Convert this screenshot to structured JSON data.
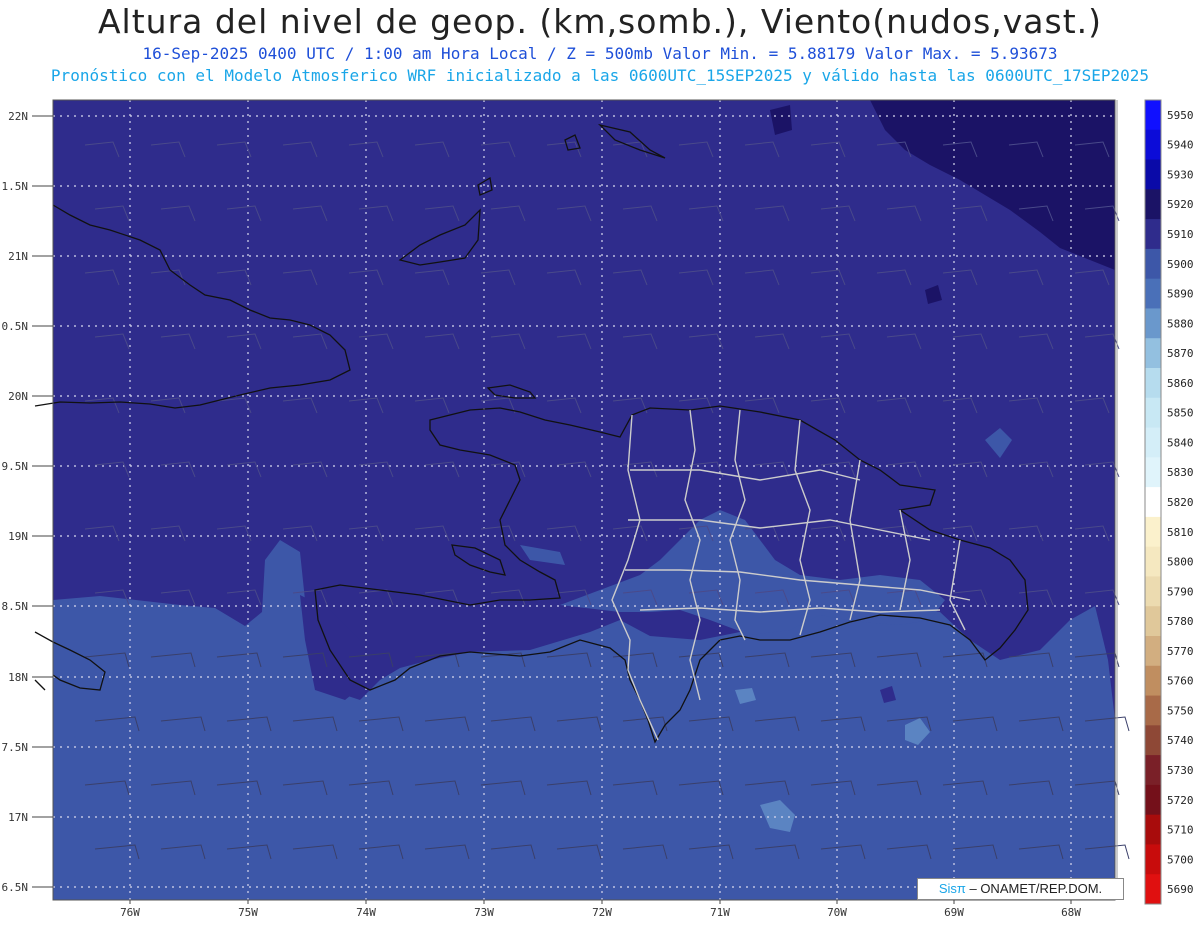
{
  "header": {
    "title": "Altura del nivel de geop. (km,somb.), Viento(nudos,vast.)",
    "subtitle": "16-Sep-2025  0400 UTC / 1:00 am Hora Local / Z = 500mb     Valor Min. = 5.88179  Valor Max. = 5.93673",
    "subtitle2": "Pronóstico con el Modelo Atmosferico WRF inicializado a las 0600UTC_15SEP2025 y válido hasta las  0600UTC_17SEP2025"
  },
  "map": {
    "lat_labels": [
      "22N",
      "1.5N",
      "21N",
      "0.5N",
      "20N",
      "9.5N",
      "19N",
      "8.5N",
      "18N",
      "7.5N",
      "17N",
      "6.5N"
    ],
    "lon_labels": [
      "76W",
      "75W",
      "74W",
      "73W",
      "72W",
      "71W",
      "70W",
      "69W",
      "68W"
    ],
    "colors": {
      "dark_navy": "#1b1366",
      "indigo": "#2f2c8c",
      "blue": "#3d57a8",
      "light_blue": "#5b84c2",
      "coast": "#111111",
      "borders": "#cccccc"
    }
  },
  "colorbar": {
    "levels": [
      {
        "label": "5950",
        "color": "#1010ff"
      },
      {
        "label": "5940",
        "color": "#0c0cd8"
      },
      {
        "label": "5930",
        "color": "#0a0aa8"
      },
      {
        "label": "5920",
        "color": "#1b1366"
      },
      {
        "label": "5910",
        "color": "#2f2c8c"
      },
      {
        "label": "5900",
        "color": "#3d57a8"
      },
      {
        "label": "5890",
        "color": "#4a70b8"
      },
      {
        "label": "5880",
        "color": "#6a98cc"
      },
      {
        "label": "5870",
        "color": "#93c0e0"
      },
      {
        "label": "5860",
        "color": "#b6dcee"
      },
      {
        "label": "5850",
        "color": "#c8e8f4"
      },
      {
        "label": "5840",
        "color": "#d4eef8"
      },
      {
        "label": "5830",
        "color": "#e0f4fb"
      },
      {
        "label": "5820",
        "color": "#ffffff"
      },
      {
        "label": "5810",
        "color": "#fbf1cc"
      },
      {
        "label": "5800",
        "color": "#f5e8c0"
      },
      {
        "label": "5790",
        "color": "#ecdbb0"
      },
      {
        "label": "5780",
        "color": "#e0c89a"
      },
      {
        "label": "5770",
        "color": "#d2ae80"
      },
      {
        "label": "5760",
        "color": "#c08e60"
      },
      {
        "label": "5750",
        "color": "#a86a48"
      },
      {
        "label": "5740",
        "color": "#8e4836"
      },
      {
        "label": "5730",
        "color": "#7a2028"
      },
      {
        "label": "5720",
        "color": "#74101a"
      },
      {
        "label": "5710",
        "color": "#a80c0c"
      },
      {
        "label": "5700",
        "color": "#c80c0c"
      },
      {
        "label": "5690",
        "color": "#e01010"
      }
    ]
  },
  "credit": {
    "logo": "Sisπ",
    "org": " – ONAMET/REP.DOM."
  }
}
